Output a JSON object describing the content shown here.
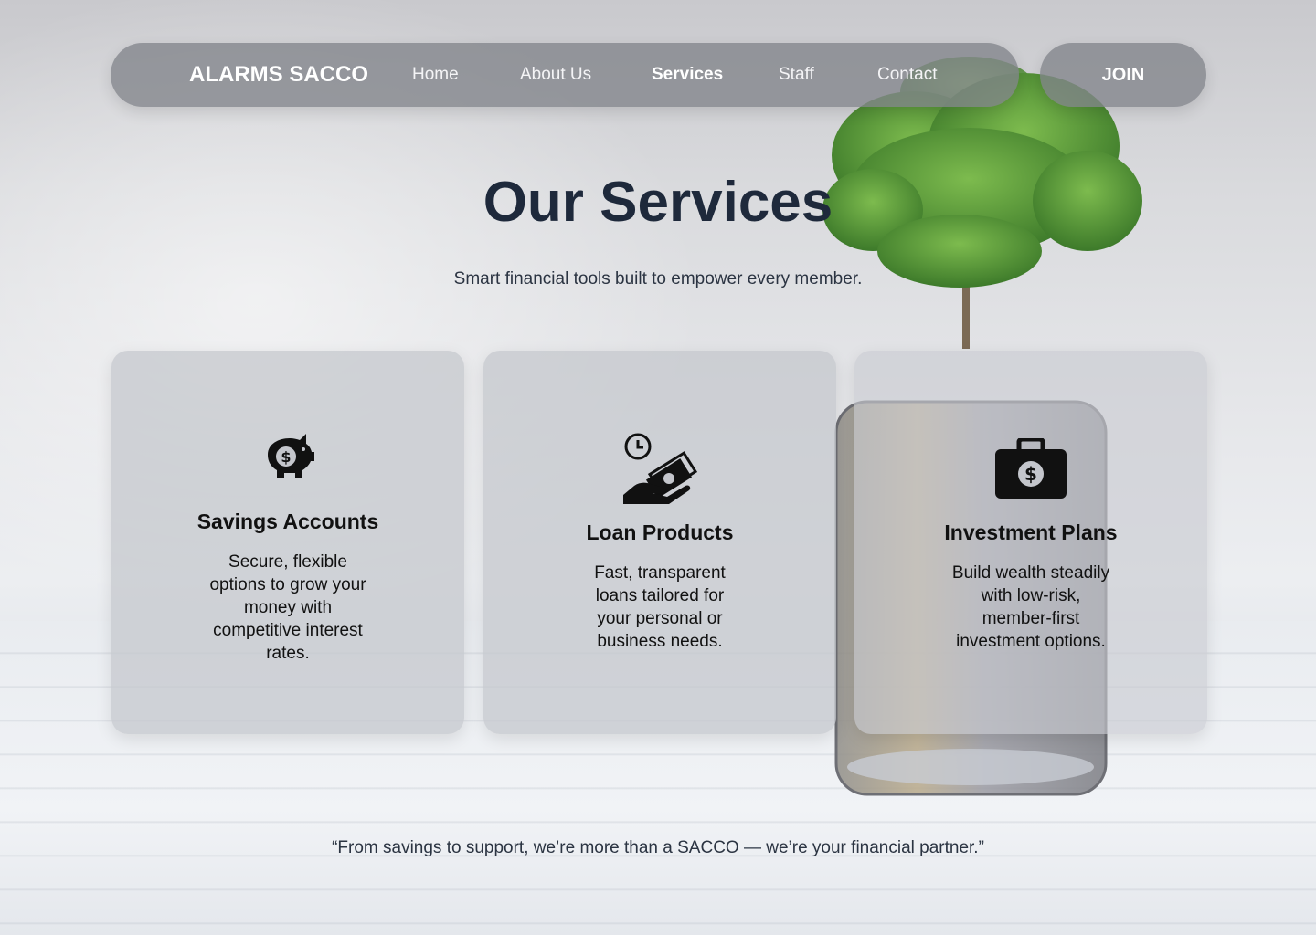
{
  "nav": {
    "brand": "ALARMS SACCO",
    "links": [
      {
        "label": "Home",
        "active": false
      },
      {
        "label": "About Us",
        "active": false
      },
      {
        "label": "Services",
        "active": true
      },
      {
        "label": "Staff",
        "active": false
      },
      {
        "label": "Contact",
        "active": false
      }
    ],
    "join_label": "JOIN"
  },
  "hero": {
    "title": "Our Services",
    "subtitle": "Smart financial tools built to empower every member."
  },
  "services": [
    {
      "icon": "piggy-bank-icon",
      "title": "Savings Accounts",
      "description": "Secure, flexible options to grow your money with competitive interest rates."
    },
    {
      "icon": "loan-hand-cash-clock-icon",
      "title": "Loan Products",
      "description": "Fast, transparent loans tailored for your personal or business needs."
    },
    {
      "icon": "money-briefcase-icon",
      "title": "Investment Plans",
      "description": "Build wealth steadily with low-risk, member-first investment options."
    }
  ],
  "quote": "“From savings to support, we’re more than a SACCO — we’re your financial partner.”",
  "colors": {
    "nav_bg": "#84868a",
    "title": "#1e293b",
    "card_bg": "#c4c6cc",
    "tree_green": "#5f9a3a"
  }
}
